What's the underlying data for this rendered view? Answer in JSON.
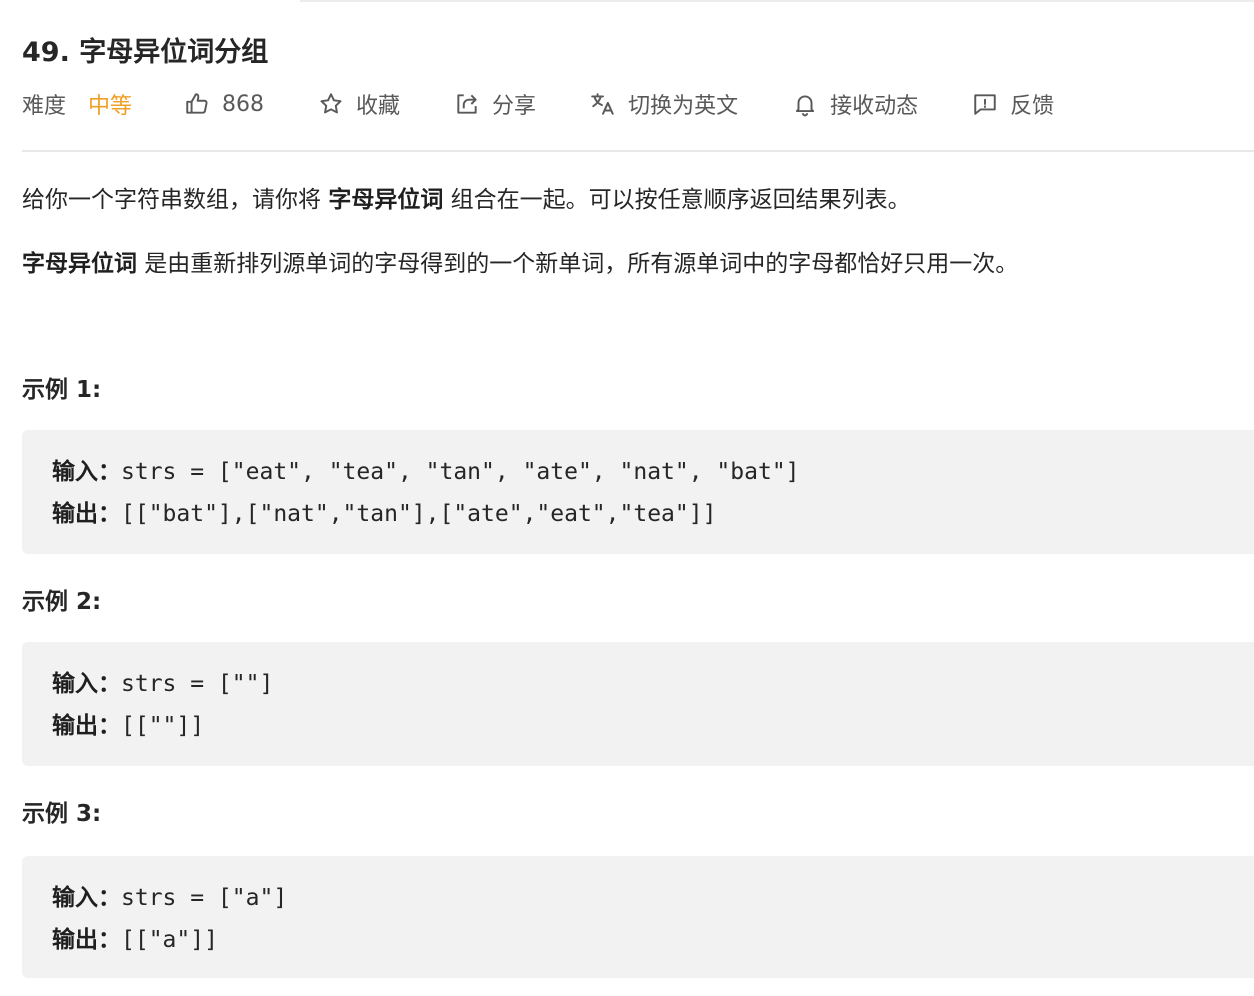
{
  "problem": {
    "title": "49. 字母异位词分组"
  },
  "meta": {
    "difficulty_label": "难度",
    "difficulty_value": "中等",
    "difficulty_color": "#ef9f26",
    "likes": "868",
    "favorite": "收藏",
    "share": "分享",
    "switch_lang": "切换为英文",
    "subscribe": "接收动态",
    "feedback": "反馈",
    "icons": [
      "thumbs-up-icon",
      "star-icon",
      "share-icon",
      "translate-icon",
      "bell-icon",
      "feedback-icon"
    ]
  },
  "description": {
    "p1_pre": "给你一个字符串数组，请你将 ",
    "p1_bold": "字母异位词",
    "p1_post": " 组合在一起。可以按任意顺序返回结果列表。",
    "p2_bold": "字母异位词",
    "p2_post": " 是由重新排列源单词的字母得到的一个新单词，所有源单词中的字母都恰好只用一次。"
  },
  "examples": [
    {
      "title": "示例 1:",
      "input_label": "输入：",
      "input": "strs = [\"eat\", \"tea\", \"tan\", \"ate\", \"nat\", \"bat\"]",
      "output_label": "输出：",
      "output": "[[\"bat\"],[\"nat\",\"tan\"],[\"ate\",\"eat\",\"tea\"]]"
    },
    {
      "title": "示例 2:",
      "input_label": "输入：",
      "input": "strs = [\"\"]",
      "output_label": "输出：",
      "output": "[[\"\"]]"
    },
    {
      "title": "示例 3:",
      "input_label": "输入：",
      "input": "strs = [\"a\"]",
      "output_label": "输出：",
      "output": "[[\"a\"]]"
    }
  ]
}
